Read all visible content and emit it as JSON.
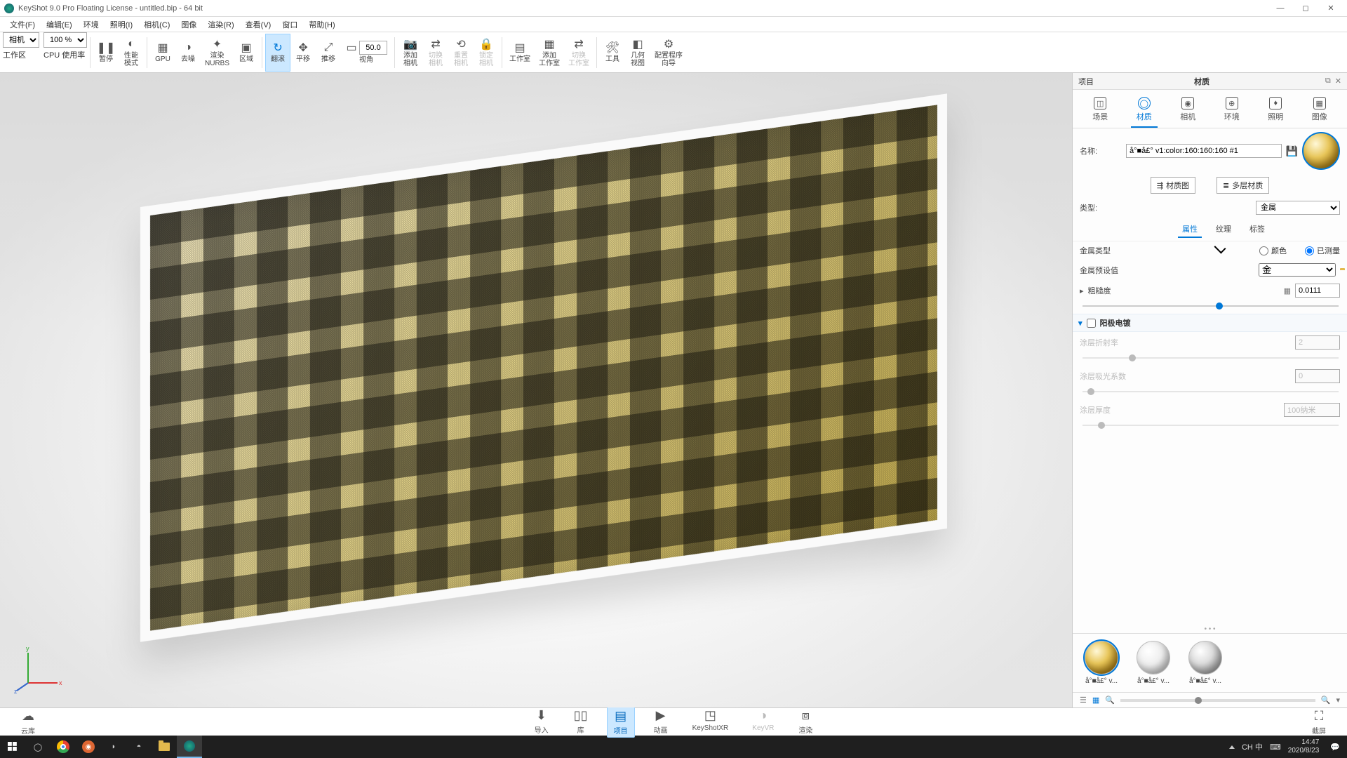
{
  "titlebar": {
    "title": "KeyShot 9.0 Pro Floating License  - untitled.bip  -  64 bit"
  },
  "menu": [
    "文件(F)",
    "编辑(E)",
    "环境",
    "照明(I)",
    "相机(C)",
    "图像",
    "渲染(R)",
    "查看(V)",
    "窗口",
    "帮助(H)"
  ],
  "toolbar": {
    "cameraSel": "相机",
    "zoomSel": "100 %",
    "items": {
      "pause": "暂停",
      "perf": "性能\n模式",
      "cpu": "CPU 使用率",
      "gpu": "GPU",
      "denoise": "去噪",
      "nurbs": "渲染\nNURBS",
      "region": "区域",
      "tumble": "翻滚",
      "pan": "平移",
      "dolly": "推移",
      "fov": "视角",
      "addcam": "添加\n相机",
      "switchcam": "切换\n相机",
      "resetcam": "重置\n相机",
      "lockcam": "锁定\n相机",
      "studio": "工作室",
      "addstudio": "添加\n工作室",
      "switchstudio": "切换\n工作室",
      "tools": "工具",
      "geom": "几何\n视图",
      "wizard": "配置程序\n向导"
    },
    "workspace": "工作区",
    "fovValue": "50.0"
  },
  "panel": {
    "left": "项目",
    "title": "材质",
    "tabs": {
      "scene": "场景",
      "material": "材质",
      "camera": "相机",
      "env": "环境",
      "light": "照明",
      "image": "图像"
    },
    "nameLabel": "名称:",
    "nameValue": "å°■å£° v1:color:160:160:160 #1",
    "matGraph": "材质图",
    "multilayer": "多层材质",
    "typeLabel": "类型:",
    "typeValue": "金属",
    "subtabs": {
      "props": "属性",
      "tex": "纹理",
      "labels": "标签"
    },
    "metalType": "金属类型",
    "color": "颜色",
    "measured": "已测量",
    "preset": "金属预设值",
    "presetValue": "金",
    "rough": "粗糙度",
    "roughValue": "0.0111",
    "anodize": "阳极电镀",
    "ior": "涂层折射率",
    "iorValue": "2",
    "absorb": "涂层吸光系数",
    "absorbValue": "0",
    "thickness": "涂层厚度",
    "thicknessValue": "100纳米",
    "swatches": [
      {
        "name": "å°■å£° v...",
        "cls": "",
        "sel": true
      },
      {
        "name": "å°■å£° v...",
        "cls": "white",
        "sel": false
      },
      {
        "name": "å°■å£° v...",
        "cls": "grey",
        "sel": false
      }
    ]
  },
  "dock": {
    "cloud": "云库",
    "import": "导入",
    "library": "库",
    "project": "项目",
    "anim": "动画",
    "xr": "KeyShotXR",
    "vr": "KeyVR",
    "render": "渲染",
    "screenshot": "截屏"
  },
  "taskbar": {
    "ime": "CH 中",
    "time": "14:47",
    "date": "2020/8/23"
  }
}
